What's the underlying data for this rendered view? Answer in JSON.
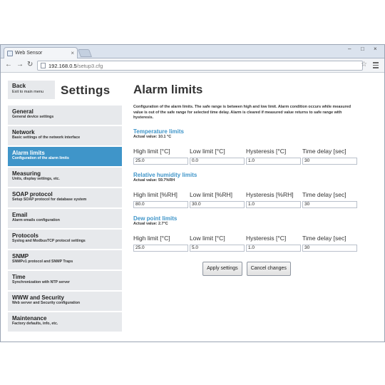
{
  "browser": {
    "tab_title": "Web Sensor",
    "tab_close": "×",
    "url_host": "192.168.0.5",
    "url_path": "/setup3.cfg",
    "icons": {
      "back": "back-arrow-icon",
      "forward": "forward-arrow-icon",
      "reload": "reload-icon",
      "star": "star-icon",
      "menu": "menu-icon"
    },
    "window_controls": {
      "minimize": "–",
      "maximize": "□",
      "close": "×"
    }
  },
  "sidebar": {
    "back_label": "Back",
    "back_sub": "Exit to main menu",
    "title": "Settings",
    "items": [
      {
        "label": "General",
        "sub": "General device settings",
        "active": false
      },
      {
        "label": "Network",
        "sub": "Basic settings of the network interface",
        "active": false
      },
      {
        "label": "Alarm limits",
        "sub": "Configuration of the alarm limits",
        "active": true
      },
      {
        "label": "Measuring",
        "sub": "Units, display settings, etc.",
        "active": false
      },
      {
        "label": "SOAP protocol",
        "sub": "Setup SOAP protocol for database system",
        "active": false
      },
      {
        "label": "Email",
        "sub": "Alarm emails configuration",
        "active": false
      },
      {
        "label": "Protocols",
        "sub": "Syslog and ModbusTCP protocol settings",
        "active": false
      },
      {
        "label": "SNMP",
        "sub": "SNMPv1 protocol and SNMP Traps",
        "active": false
      },
      {
        "label": "Time",
        "sub": "Synchronization with NTP server",
        "active": false
      },
      {
        "label": "WWW and Security",
        "sub": "Web server and Security configuration",
        "active": false
      },
      {
        "label": "Maintenance",
        "sub": "Factory defaults, info, etc.",
        "active": false
      }
    ]
  },
  "main": {
    "title": "Alarm limits",
    "description": "Configuration of the alarm limits. The safe range is between high and low limit. Alarm condition occurs while measured value is out of the safe range for selected time delay. Alarm is cleared if measured value returns to safe range with hysteresis.",
    "sections": [
      {
        "title": "Temperature limits",
        "actual": "Actual value: 10.1 °C",
        "fields": [
          {
            "label": "High limit [°C]",
            "value": "25.0"
          },
          {
            "label": "Low limit [°C]",
            "value": "0.0"
          },
          {
            "label": "Hysteresis [°C]",
            "value": "1.0"
          },
          {
            "label": "Time delay [sec]",
            "value": "30"
          }
        ]
      },
      {
        "title": "Relative humidity limits",
        "actual": "Actual value: 59.7%RH",
        "fields": [
          {
            "label": "High limit [%RH]",
            "value": "80.0"
          },
          {
            "label": "Low limit [%RH]",
            "value": "30.0"
          },
          {
            "label": "Hysteresis [%RH]",
            "value": "1.0"
          },
          {
            "label": "Time delay [sec]",
            "value": "30"
          }
        ]
      },
      {
        "title": "Dew point limits",
        "actual": "Actual value: 2.7°C",
        "fields": [
          {
            "label": "High limit [°C]",
            "value": "25.0"
          },
          {
            "label": "Low limit [°C]",
            "value": "5.0"
          },
          {
            "label": "Hysteresis [°C]",
            "value": "1.0"
          },
          {
            "label": "Time delay [sec]",
            "value": "30"
          }
        ]
      }
    ],
    "apply_label": "Apply settings",
    "cancel_label": "Cancel changes"
  },
  "colors": {
    "accent": "#3f95c9",
    "nav_background": "#e7e9ec"
  }
}
